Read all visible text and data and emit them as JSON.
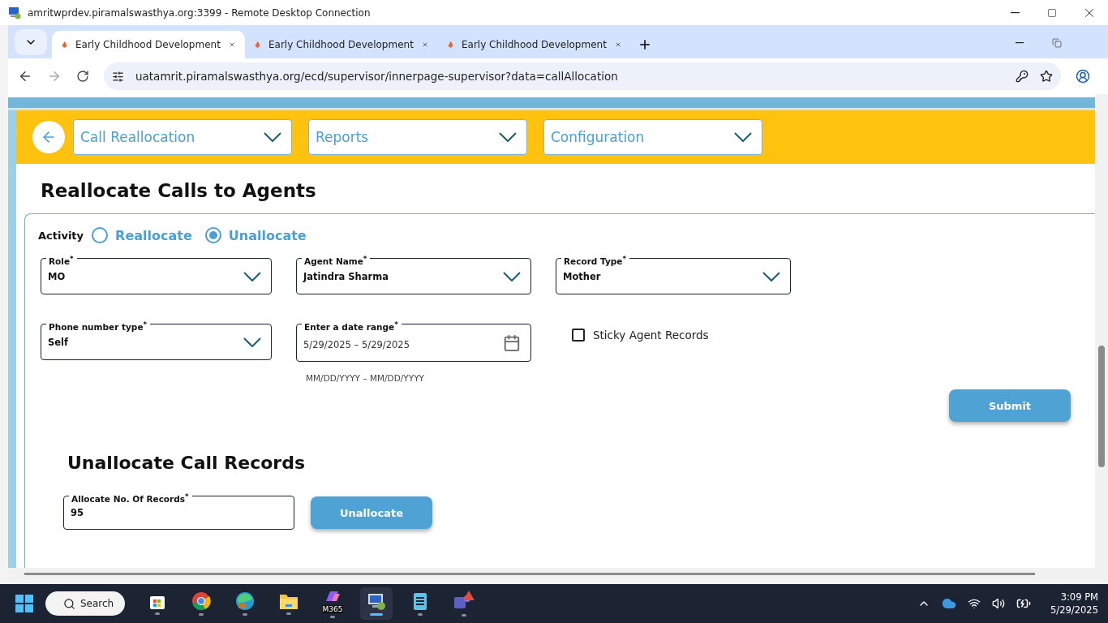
{
  "window": {
    "title": "amritwprdev.piramalswasthya.org:3399 - Remote Desktop Connection"
  },
  "browser": {
    "tabs": [
      {
        "label": "Early Childhood Development",
        "selected": true
      },
      {
        "label": "Early Childhood Development",
        "selected": false
      },
      {
        "label": "Early Childhood Development",
        "selected": false
      }
    ],
    "url": "uatamrit.piramalswasthya.org/ecd/supervisor/innerpage-supervisor?data=callAllocation"
  },
  "nav_menus": [
    "Call Reallocation",
    "Reports",
    "Configuration"
  ],
  "heading": "Reallocate Calls to Agents",
  "activity": {
    "label": "Activity",
    "options": [
      {
        "label": "Reallocate",
        "selected": false
      },
      {
        "label": "Unallocate",
        "selected": true
      }
    ]
  },
  "fields": [
    {
      "kind": "select",
      "label": "Role$^{*}$",
      "value": "MO"
    },
    {
      "kind": "select",
      "label": "Agent Name$^{*}$",
      "value": "Jatindra Sharma"
    },
    {
      "kind": "select",
      "label": "Record Type$^{*}$",
      "value": "Mother"
    },
    {
      "kind": "select",
      "label": "Phone number type$^{*}$",
      "value": "Self"
    },
    {
      "kind": "date",
      "label": "Enter a date range$^{*}$",
      "start": "5/29/2025",
      "separator": "–",
      "end": "5/29/2025",
      "hint": "MM/DD/YYYY – MM/DD/YYYY"
    },
    {
      "kind": "checkbox",
      "label": "Sticky Agent Records",
      "checked": false
    }
  ],
  "submit": "Submit",
  "unallocate": {
    "heading": "Unallocate Call Records",
    "field_label": "Allocate No. Of Records$^{*}$",
    "value": "95",
    "button": "Unallocate"
  },
  "taskbar": {
    "search": "Search",
    "apps": [
      {
        "kind": "store",
        "selected": false
      },
      {
        "kind": "chrome",
        "selected": false
      },
      {
        "kind": "edge",
        "selected": false
      },
      {
        "kind": "folder",
        "selected": false
      },
      {
        "kind": "m365",
        "label": "M365",
        "selected": false
      },
      {
        "kind": "remote",
        "selected": true
      },
      {
        "kind": "notepad",
        "selected": false
      },
      {
        "kind": "teams",
        "selected": false
      }
    ],
    "time": "3:09 PM",
    "date": "5/29/2025"
  }
}
